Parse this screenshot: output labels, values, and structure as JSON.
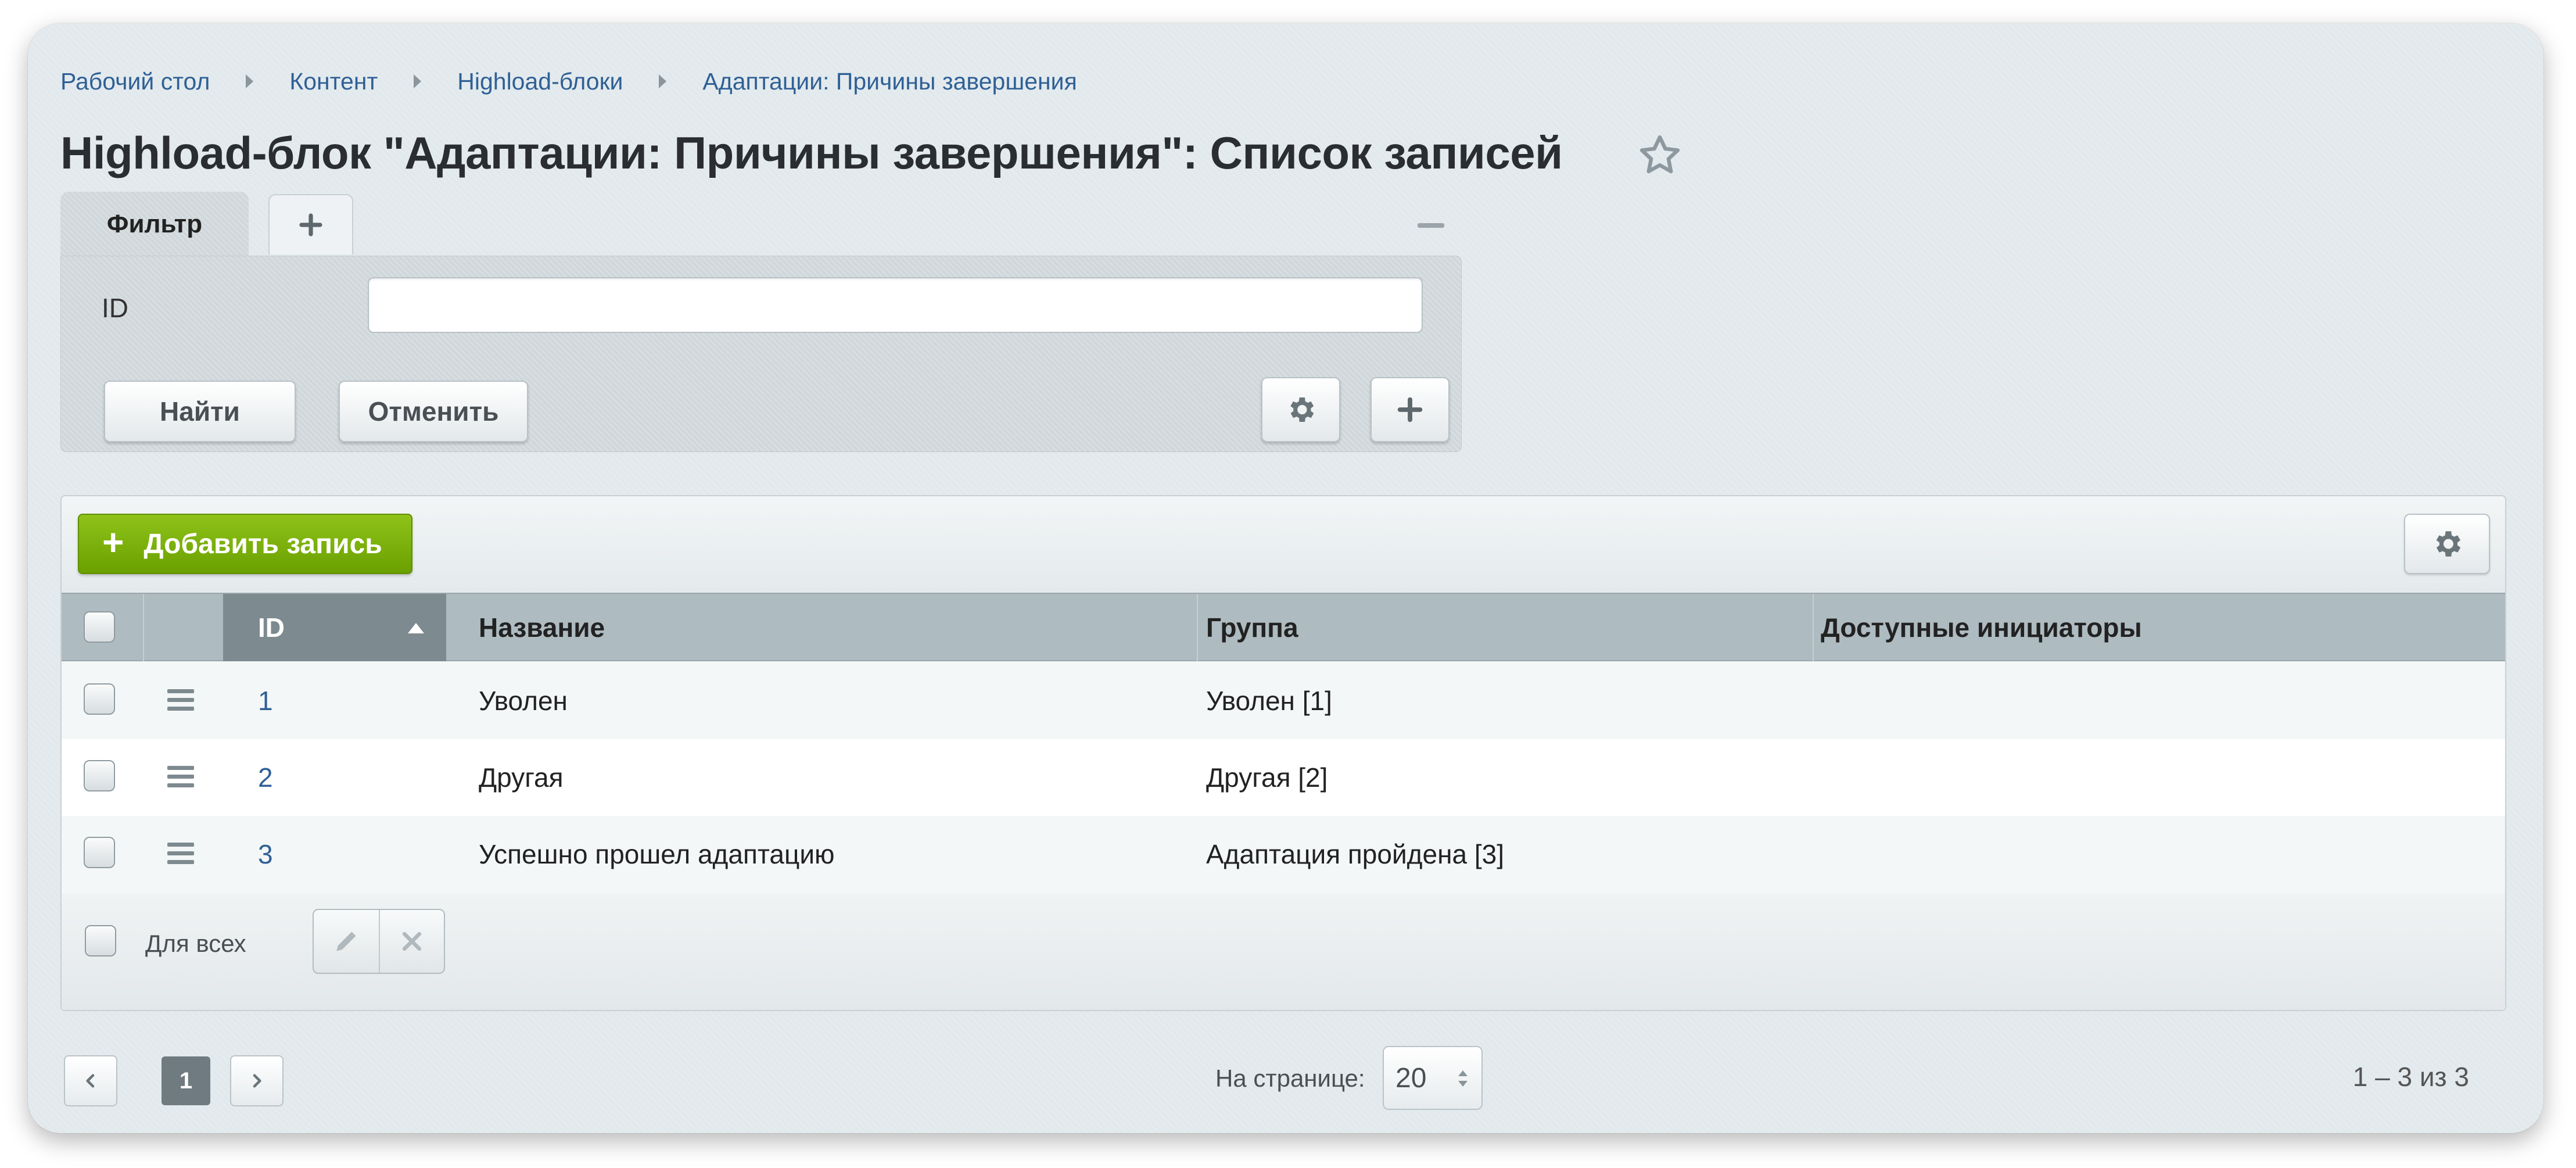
{
  "breadcrumb": [
    "Рабочий стол",
    "Контент",
    "Highload-блоки",
    "Адаптации: Причины завершения"
  ],
  "page_title": "Highload-блок \"Адаптации: Причины завершения\": Список записей",
  "filter": {
    "tab_label": "Фильтр",
    "field_label": "ID",
    "field_value": "",
    "find_label": "Найти",
    "cancel_label": "Отменить"
  },
  "toolbar": {
    "add_label": "Добавить запись"
  },
  "table": {
    "columns": [
      "ID",
      "Название",
      "Группа",
      "Доступные инициаторы"
    ],
    "rows": [
      {
        "id": "1",
        "name": "Уволен",
        "group": "Уволен [1]",
        "initiators": ""
      },
      {
        "id": "2",
        "name": "Другая",
        "group": "Другая [2]",
        "initiators": ""
      },
      {
        "id": "3",
        "name": "Успешно прошел адаптацию",
        "group": "Адаптация пройдена [3]",
        "initiators": ""
      }
    ]
  },
  "footer": {
    "for_all_label": "Для всех"
  },
  "pagination": {
    "current_page": "1",
    "per_page_label": "На странице:",
    "per_page_value": "20",
    "range_text": "1 – 3 из 3"
  },
  "colors": {
    "link": "#2f6096",
    "add_button": "#7cb30c",
    "header_bg": "#aebbc0",
    "active_header": "#7d8a90"
  },
  "icons": {
    "favorite": "star-icon",
    "settings": "gear-icon",
    "add": "plus-icon",
    "collapse": "minus-icon",
    "row_menu": "hamburger-icon",
    "edit": "pencil-icon",
    "delete": "close-icon"
  }
}
